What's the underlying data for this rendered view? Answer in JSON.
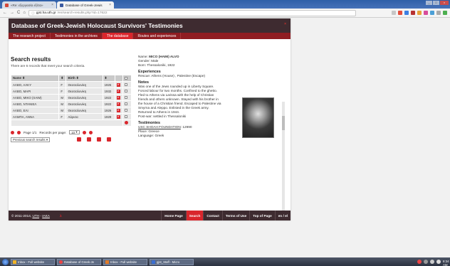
{
  "browser": {
    "tabs": [
      {
        "label": "«Re: εξεργασία εξέτα»",
        "active": false
      },
      {
        "label": "Database of Greek-Jewis",
        "active": true
      }
    ],
    "url_host": "gjst.ha.uth.gr",
    "url_path": "/en/search-results.php?id=17622"
  },
  "site": {
    "title": "Database of Greek-Jewish Holocaust Survivors' Testimonies",
    "nav": [
      {
        "label": "The research project"
      },
      {
        "label": "Testimonies in the archives"
      },
      {
        "label": "The database"
      },
      {
        "label": "Routes and experiences"
      }
    ]
  },
  "search": {
    "title": "Search results",
    "subtitle": "There are 6 records that meet your search criteria.",
    "headers": {
      "name": "Name",
      "birth": "Birth"
    },
    "rows": [
      {
        "name": "ΑΛΒΟ, ΑΛΚΥ",
        "sex": "F",
        "place": "Θεσσαλονίκη",
        "year": "1926"
      },
      {
        "name": "ΑΛΒΟ, ΜΑΡΙ",
        "sex": "F",
        "place": "Θεσσαλονίκη",
        "year": "1932"
      },
      {
        "name": "ΑΛΒΟ, ΜΙΚΟ (ΧΑΙΜ)",
        "sex": "M",
        "place": "Θεσσαλονίκη",
        "year": "1922"
      },
      {
        "name": "ΑΛΒΟ, ΝΤΑΝΙΕΛ",
        "sex": "M",
        "place": "Θεσσαλονίκη",
        "year": "1922"
      },
      {
        "name": "ΑΛΒΟ, ΕΛΙ",
        "sex": "M",
        "place": "Θεσσαλονίκη",
        "year": "1926"
      },
      {
        "name": "ΑΛΜΠΑ, ΑΝΝΑ",
        "sex": "F",
        "place": "Λάρισα",
        "year": "1929"
      }
    ],
    "page_label": "Page 1/1",
    "per_page_label": "Records per page:",
    "per_page_value": "10",
    "prev_label": "Previous search results"
  },
  "detail": {
    "name_label": "Name:",
    "name_value": "MICO (HAIM) ALVO",
    "gender": "Gender: Male",
    "born": "Born: Thessaloniki, 1922",
    "experiences_title": "Experiences",
    "experiences": "Rescue: Athens (House) , Palestine (Escape)",
    "notes_title": "Notes",
    "notes": "Was one of the Jews rounded up in Liberty Square. Forced labour for two months. Confined to the ghetto. Fled to Athens via Larissa with the help of Christian friends and others unknown. Stayed with his brother in the house of a Christian friend. Escaped to Palestine via Smyrna and Aleppo. Enlisted in the Greek army. Returned to Athens in 1944.",
    "postwar": "Post-war: settled in Thessaloniki",
    "testimonies_title": "Testimonies",
    "foundation": "USC SHOAH FOUNDATION",
    "foundation_id": ": 12990",
    "place": "Place: Greece",
    "language": "Language: Greek"
  },
  "footer": {
    "copyright": "© 2011-2014, ",
    "uth": "UTH",
    "sep": " - ",
    "iaka": "IAKA",
    "links": [
      {
        "label": "Home Page"
      },
      {
        "label": "Search"
      },
      {
        "label": "Contact"
      },
      {
        "label": "Terms of Use"
      },
      {
        "label": "Top of Page"
      },
      {
        "label": "en / el"
      }
    ]
  },
  "taskbar": {
    "items": [
      {
        "label": "Inbox - Full website"
      },
      {
        "label": "Database of Greek-Je"
      },
      {
        "label": "Inbox - Full website"
      },
      {
        "label": "gjst_Staff - Micro"
      }
    ],
    "clock": "8:34 AM"
  },
  "colors": {
    "accent": "#d9262c",
    "header": "#3e2b30",
    "nav": "#8f1d22"
  }
}
